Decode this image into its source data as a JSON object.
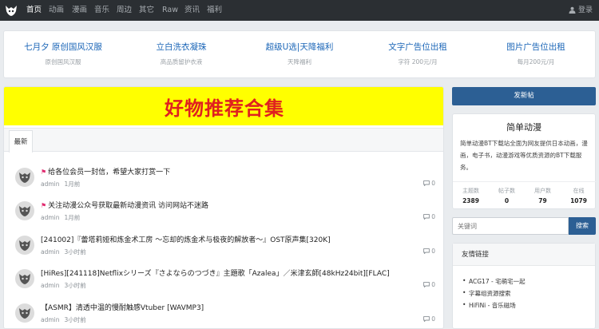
{
  "nav": {
    "items": [
      "首页",
      "动画",
      "漫画",
      "音乐",
      "周边",
      "其它",
      "Raw",
      "资讯",
      "福利"
    ],
    "active_index": 0,
    "login": "登录"
  },
  "ads": [
    {
      "title": "七月夕 原创国风汉服",
      "sub": "原创国风汉服"
    },
    {
      "title": "立白洗衣凝珠",
      "sub": "高品质留护衣液"
    },
    {
      "title": "超级U选|天降福利",
      "sub": "天降福利"
    },
    {
      "title": "文字广告位出租",
      "sub": "字符 200元/月"
    },
    {
      "title": "图片广告位出租",
      "sub": "每月200元/月"
    }
  ],
  "banner": {
    "text": "好物推荐合集",
    "bg_color": "#ffff00",
    "text_color": "#e0201f"
  },
  "tabs": {
    "latest": "最新"
  },
  "threads": [
    {
      "pinned": true,
      "title": "给各位会员一封信，希望大家打赏一下",
      "author": "admin",
      "time": "1月前",
      "replies": "0"
    },
    {
      "pinned": true,
      "title": "关注动漫公众号获取最新动漫资讯 访问网站不迷路",
      "author": "admin",
      "time": "1月前",
      "replies": "0"
    },
    {
      "pinned": false,
      "title": "[241002]『蕾塔莉娅和炼金术工房 ～忘却的炼金术与极夜的解放者～』OST原声集[320K]",
      "author": "admin",
      "time": "3小时前",
      "replies": "0"
    },
    {
      "pinned": false,
      "title": "[HiRes][241118]Netflixシリーズ『さよならのつづき』主題歌「Azalea」／米津玄師[48kHz24bit][FLAC]",
      "author": "admin",
      "time": "3小时前",
      "replies": "0"
    },
    {
      "pinned": false,
      "title": "【ASMR】清透中温的慢耐触感Vtuber [WAVMP3]",
      "author": "admin",
      "time": "3小时前",
      "replies": "0"
    }
  ],
  "sidebar": {
    "post_button": "发新帖",
    "site_name": "简单动漫",
    "site_desc": "简单动漫BT下载站全面为网友提供日本动画，漫画，电子书，动漫游戏等优质资源的BT下载服务。",
    "stats": [
      {
        "label": "主题数",
        "value": "2389"
      },
      {
        "label": "帖子数",
        "value": "0"
      },
      {
        "label": "用户数",
        "value": "79"
      },
      {
        "label": "在线",
        "value": "1079"
      }
    ],
    "search_placeholder": "关键词",
    "search_button": "搜索",
    "links_title": "友情链接",
    "links": [
      "ACG17 - 宅萌宅一起",
      "字幕组资源搜索",
      "HiFiNi - 音乐磁场"
    ]
  },
  "colors": {
    "brand": "#2c5f94",
    "nav_bg": "#2b2f33",
    "link": "#1a65b7",
    "pin": "#e02a6f"
  }
}
